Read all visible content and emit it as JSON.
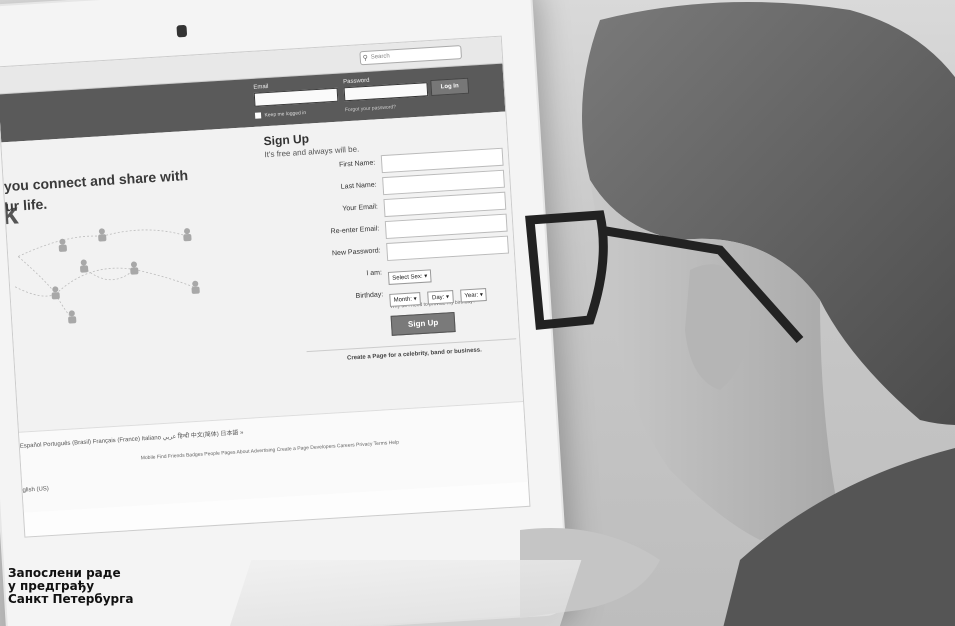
{
  "browser": {
    "search_placeholder": "Search"
  },
  "header": {
    "email_label": "Email",
    "password_label": "Password",
    "login_button": "Log In",
    "keep_logged_in": "Keep me logged in",
    "forgot_password": "Forgot your password?",
    "logo_fragment": "k"
  },
  "main": {
    "tagline_line1": "you connect and share with",
    "tagline_line2": "ur life."
  },
  "signup": {
    "title": "Sign Up",
    "subtitle": "It's free and always will be.",
    "fields": [
      {
        "label": "First Name:"
      },
      {
        "label": "Last Name:"
      },
      {
        "label": "Your Email:"
      },
      {
        "label": "Re-enter Email:"
      },
      {
        "label": "New Password:"
      }
    ],
    "iam_label": "I am:",
    "sex_select": "Select Sex:",
    "birthday_label": "Birthday:",
    "month_select": "Month:",
    "day_select": "Day:",
    "year_select": "Year:",
    "why_birthday": "Why do I need to provide my birthday?",
    "button": "Sign Up",
    "page_link": "Create a Page for a celebrity, band or business."
  },
  "footer": {
    "languages": "Español  Português (Brasil)  Français (France)  Italiano  عربي  हिन्दी  中文(简体)  日本語  »",
    "links": "Mobile  Find Friends  Badges  People  Pages  About  Advertising  Create a Page  Developers  Careers  Privacy  Terms  Help",
    "language_last": "glish (US)"
  },
  "caption": {
    "line1": "Запослени раде",
    "line2": "у предграђу",
    "line3": "Санкт Петербурга"
  },
  "colors": {
    "header_bg": "#5a5a5a",
    "caption_text": "#111111"
  }
}
